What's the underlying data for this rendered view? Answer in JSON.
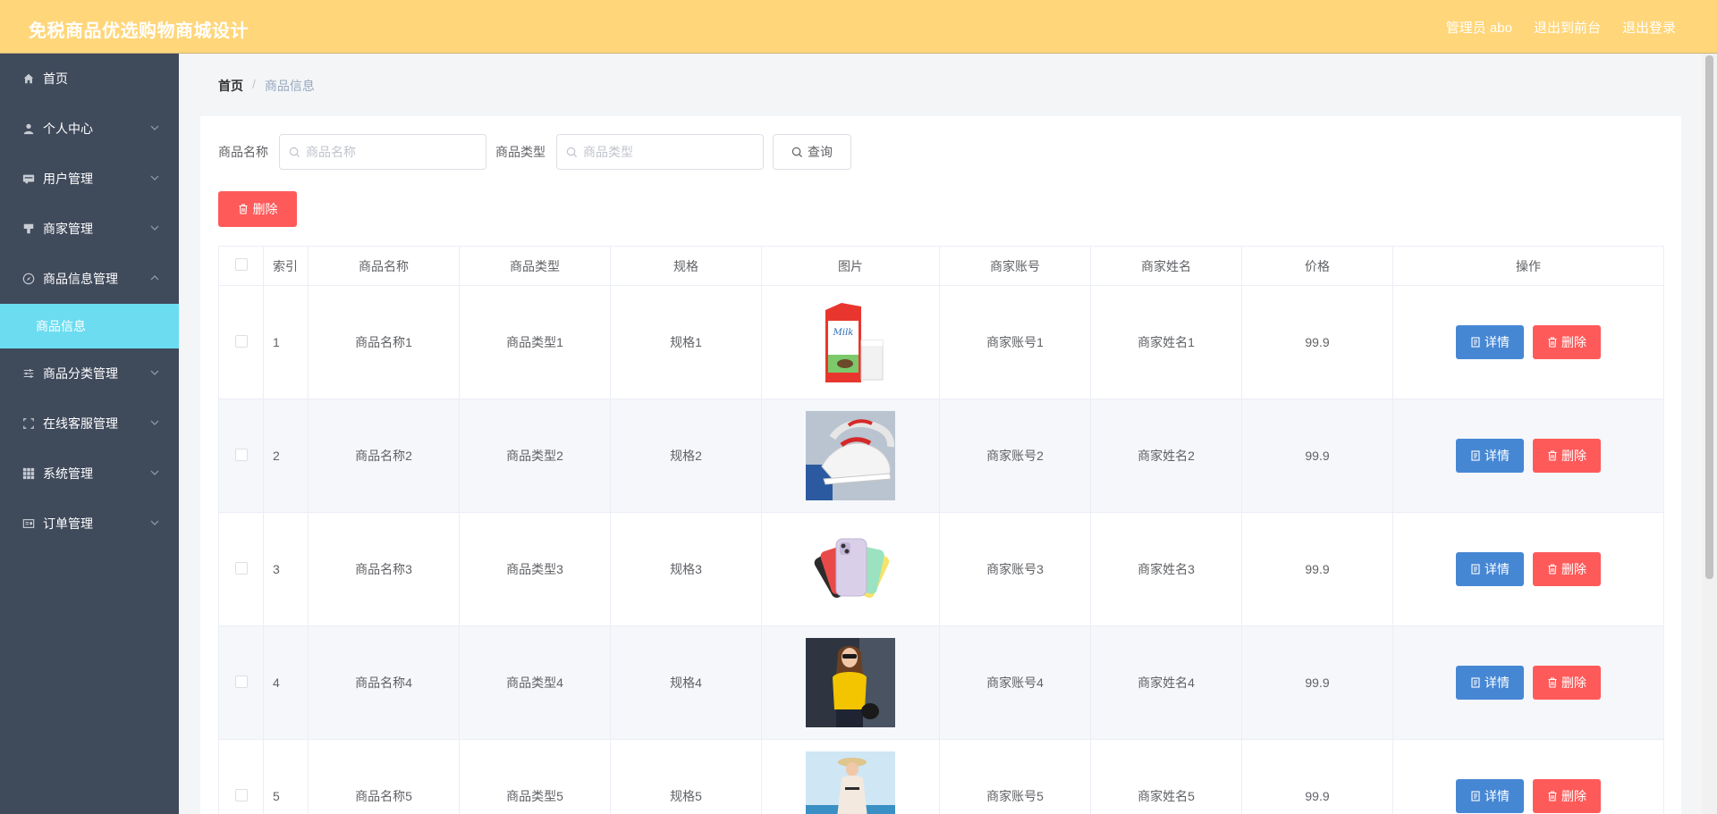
{
  "app": {
    "title": "免税商品优选购物商城设计"
  },
  "header": {
    "admin_label": "管理员 abo",
    "back_label": "退出到前台",
    "logout_label": "退出登录"
  },
  "sidebar": {
    "items": [
      {
        "label": "首页",
        "icon": "home-icon"
      },
      {
        "label": "个人中心",
        "icon": "user-icon"
      },
      {
        "label": "用户管理",
        "icon": "users-icon"
      },
      {
        "label": "商家管理",
        "icon": "shop-icon"
      },
      {
        "label": "商品信息管理",
        "icon": "compass-icon",
        "expanded": true
      },
      {
        "label": "商品分类管理",
        "icon": "sliders-icon"
      },
      {
        "label": "在线客服管理",
        "icon": "fullscreen-icon"
      },
      {
        "label": "系统管理",
        "icon": "grid-icon"
      },
      {
        "label": "订单管理",
        "icon": "order-icon"
      }
    ],
    "submenu": {
      "label": "商品信息"
    }
  },
  "breadcrumb": {
    "home": "首页",
    "separator": "/",
    "current": "商品信息"
  },
  "filters": {
    "name_label": "商品名称",
    "name_placeholder": "商品名称",
    "type_label": "商品类型",
    "type_placeholder": "商品类型",
    "query_label": "查询"
  },
  "toolbar": {
    "delete_label": "删除"
  },
  "table": {
    "headers": [
      "索引",
      "商品名称",
      "商品类型",
      "规格",
      "图片",
      "商家账号",
      "商家姓名",
      "价格",
      "操作"
    ],
    "detail_label": "详情",
    "delete_label": "删除",
    "rows": [
      {
        "index": "1",
        "name": "商品名称1",
        "type": "商品类型1",
        "spec": "规格1",
        "image": "milk-carton",
        "account": "商家账号1",
        "merchant": "商家姓名1",
        "price": "99.9"
      },
      {
        "index": "2",
        "name": "商品名称2",
        "type": "商品类型2",
        "spec": "规格2",
        "image": "white-sneakers",
        "account": "商家账号2",
        "merchant": "商家姓名2",
        "price": "99.9"
      },
      {
        "index": "3",
        "name": "商品名称3",
        "type": "商品类型3",
        "spec": "规格3",
        "image": "colorful-phones",
        "account": "商家账号3",
        "merchant": "商家姓名3",
        "price": "99.9"
      },
      {
        "index": "4",
        "name": "商品名称4",
        "type": "商品类型4",
        "spec": "规格4",
        "image": "yellow-top-woman",
        "account": "商家账号4",
        "merchant": "商家姓名4",
        "price": "99.9"
      },
      {
        "index": "5",
        "name": "商品名称5",
        "type": "商品类型5",
        "spec": "规格5",
        "image": "beach-dress-woman",
        "account": "商家账号5",
        "merchant": "商家姓名5",
        "price": "99.9"
      }
    ]
  },
  "colors": {
    "header_bg": "#ffd67a",
    "sidebar_bg": "#3f4a5b",
    "submenu_active": "#6cdcf0",
    "primary": "#4687d4",
    "danger": "#ff5a5a"
  }
}
